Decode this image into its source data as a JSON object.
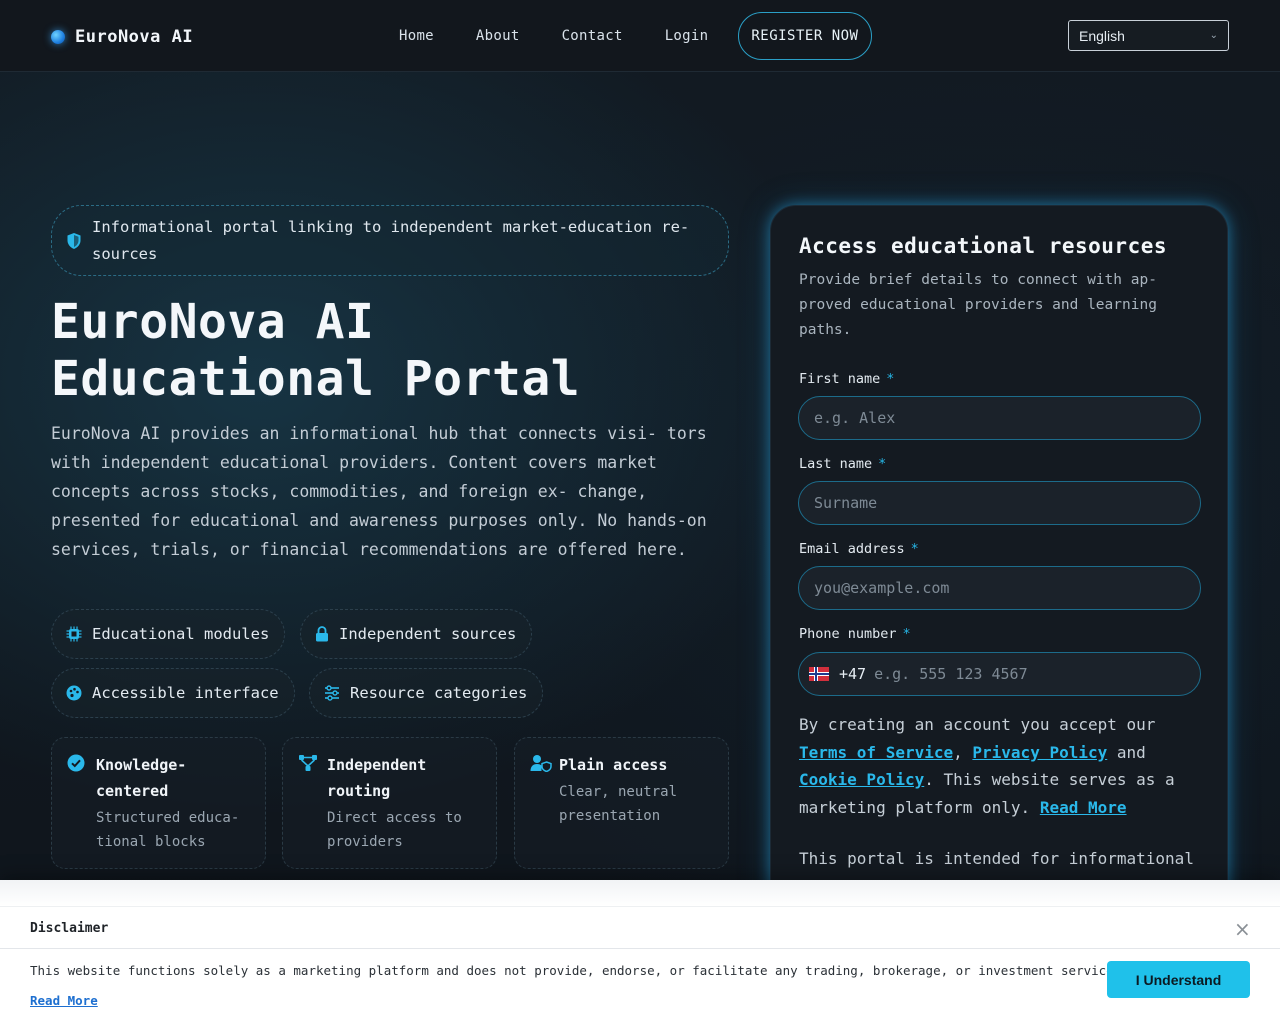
{
  "header": {
    "brand": "EuroNova AI",
    "nav": [
      "Home",
      "About",
      "Contact",
      "Login"
    ],
    "register_label": "REGISTER NOW",
    "language": "English"
  },
  "hero": {
    "notice": "Informational portal linking to independent market-education re- sources",
    "title_line1": "EuroNova AI",
    "title_line2": "Educational Portal",
    "description": "EuroNova AI provides an informational hub that connects visi- tors with independent educational providers. Content covers market concepts across stocks, commodities, and foreign ex- change, presented for educational and awareness purposes only. No hands-on services, trials, or financial recommendations are offered here.",
    "pills": [
      {
        "label": "Educational modules",
        "icon": "chip-icon"
      },
      {
        "label": "Independent sources",
        "icon": "lock-icon"
      },
      {
        "label": "Accessible interface",
        "icon": "palette-icon"
      },
      {
        "label": "Resource categories",
        "icon": "sliders-icon"
      }
    ],
    "cards": [
      {
        "title": "Knowledge- centered",
        "subtitle": "Structured educa- tional blocks",
        "icon": "check-circle-icon"
      },
      {
        "title": "Independent routing",
        "subtitle": "Direct access to providers",
        "icon": "network-icon"
      },
      {
        "title": "Plain access",
        "subtitle": "Clear, neutral presentation",
        "icon": "user-shield-icon"
      }
    ]
  },
  "form": {
    "title": "Access educational resources",
    "subtitle": "Provide brief details to connect with ap- proved educational providers and learning paths.",
    "required_mark": "*",
    "first_name_label": "First name",
    "first_name_placeholder": "e.g. Alex",
    "last_name_label": "Last name",
    "last_name_placeholder": "Surname",
    "email_label": "Email address",
    "email_placeholder": "you@example.com",
    "phone_label": "Phone number",
    "phone_dial_code": "+47",
    "phone_placeholder": "e.g. 555 123 4567",
    "terms_prefix": "By creating an account you accept our",
    "terms_link": "Terms of Service",
    "privacy_link": "Privacy Policy",
    "and_text": "and",
    "cookie_link": "Cookie Policy",
    "terms_suffix": ". This website serves as a marketing platform only.",
    "read_more": "Read More",
    "intended_text": "This portal is intended for informational"
  },
  "banner": {
    "title": "Disclaimer",
    "close": "×",
    "text": "This website functions solely as a marketing platform and does not provide, endorse, or facilitate any trading, brokerage, or investment services.",
    "read_more": "Read More",
    "button": "I Understand"
  },
  "colors": {
    "accent": "#26b6e6",
    "background": "#0f151c",
    "button": "#1fc1ea"
  }
}
